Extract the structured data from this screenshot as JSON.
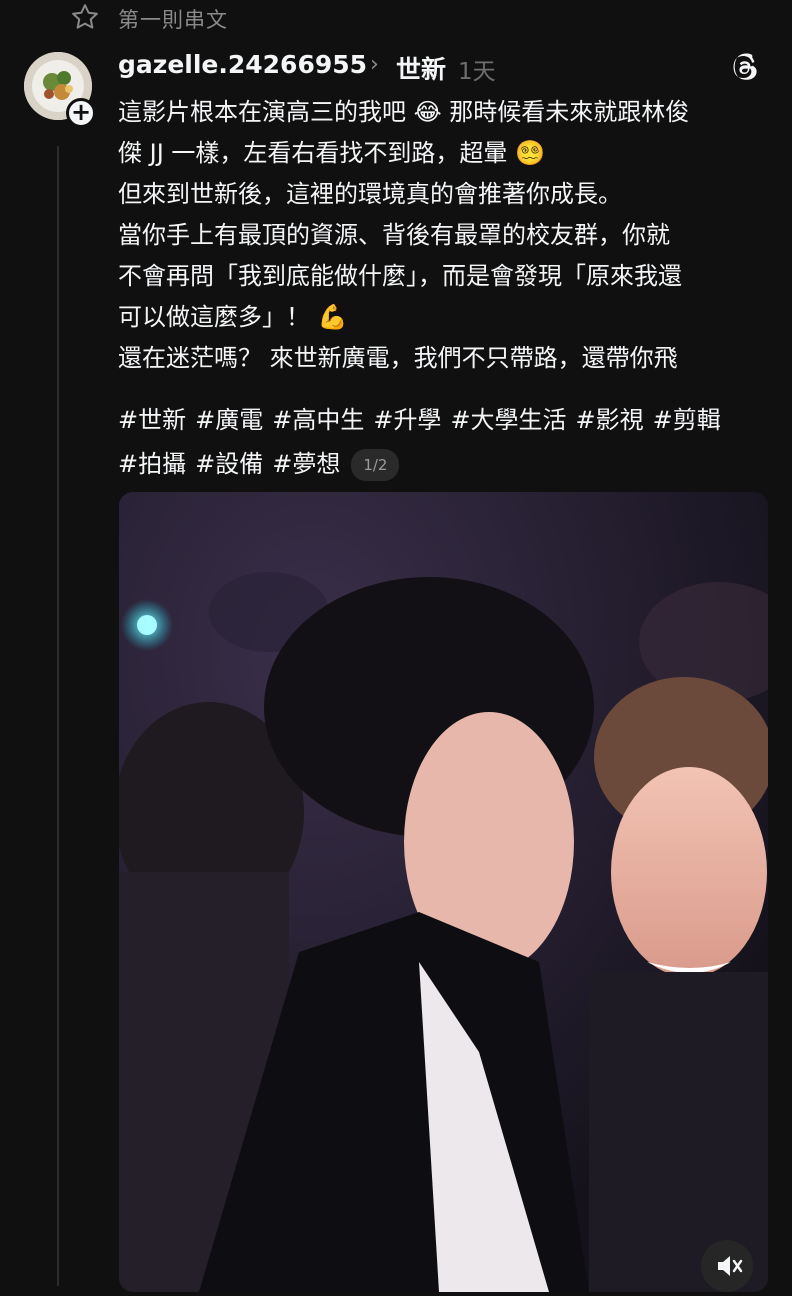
{
  "header": {
    "title": "第一則串文",
    "icon": "star-icon"
  },
  "post": {
    "username": "gazelle.24266955",
    "topic": "世新",
    "time": "1天",
    "lines": [
      "這影片根本在演高三的我吧 😂 那時候看未來就跟林俊",
      "傑 JJ 一樣，左看右看找不到路，超暈 😵‍💫",
      "但來到世新後，這裡的環境真的會推著你成長。",
      "當你手上有最頂的資源、背後有最罩的校友群，你就",
      "不會再問「我到底能做什麼」，而是會發現「原來我還",
      "可以做這麼多」！ 💪",
      "還在迷茫嗎？ 來世新廣電，我們不只帶路，還帶你飛"
    ],
    "tags": [
      "#世新",
      "#廣電",
      "#高中生",
      "#升學",
      "#大學生活",
      "#影視",
      "#剪輯",
      "#拍攝",
      "#設備",
      "#夢想"
    ],
    "pager": "1/2"
  },
  "colors": {
    "background": "#101010",
    "text": "#f3f5f7",
    "muted": "#8a8a8a"
  }
}
